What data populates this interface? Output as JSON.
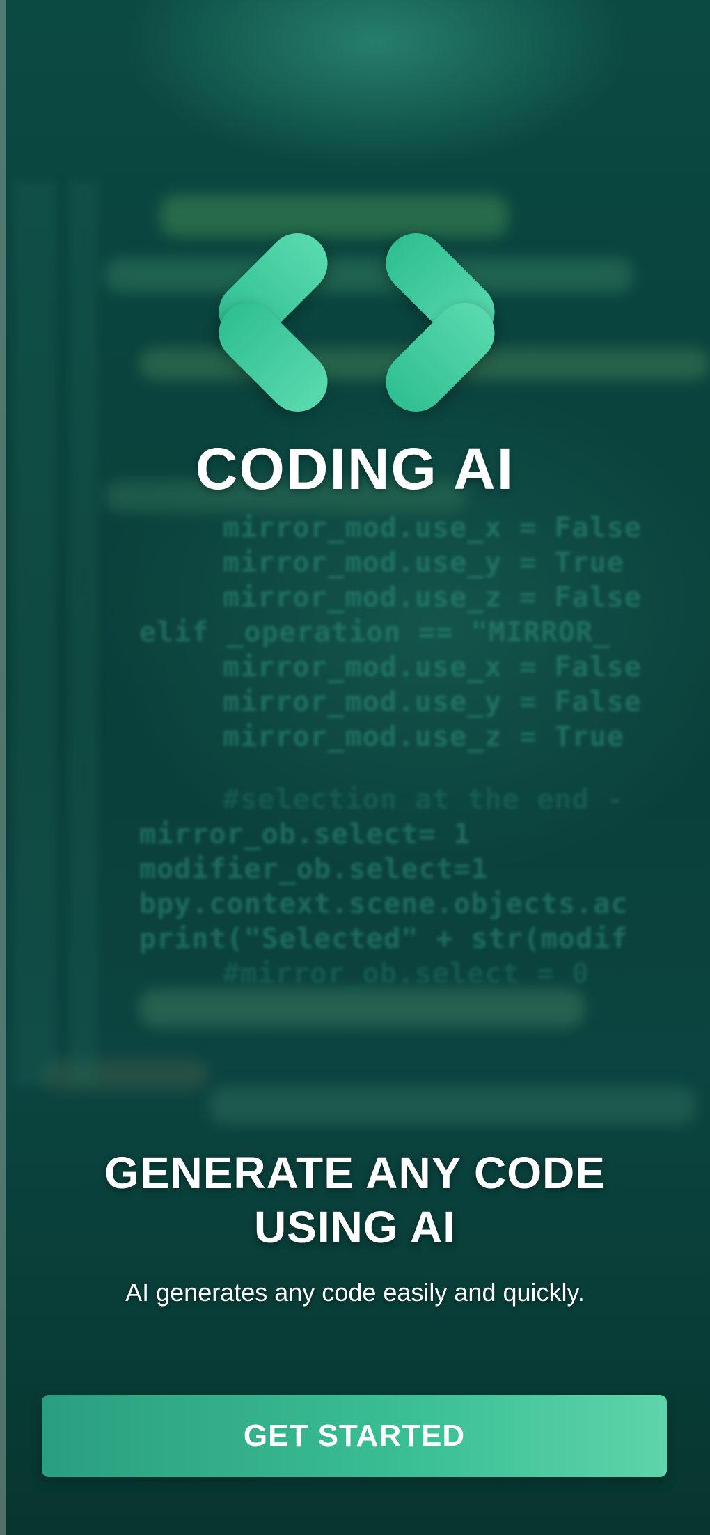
{
  "app": {
    "title": "CODING AI",
    "logo_icon": "code-brackets-icon"
  },
  "onboarding": {
    "headline_line1": "GENERATE ANY CODE",
    "headline_line2": "USING AI",
    "subtitle": "AI generates any code easily and quickly."
  },
  "cta": {
    "label": "GET STARTED"
  },
  "background": {
    "code_lines": [
      "mirror_mod.use_x = False",
      "mirror_mod.use_y = True",
      "mirror_mod.use_z = False",
      "elif _operation == \"MIRROR_",
      "mirror_mod.use_x = False",
      "mirror_mod.use_y = False",
      "mirror_mod.use_z = True",
      "#selection at the end -",
      "mirror_ob.select= 1",
      "modifier_ob.select=1",
      "bpy.context.scene.objects.ac",
      "print(\"Selected\" + str(modif",
      "#mirror_ob.select = 0"
    ]
  },
  "colors": {
    "accent": "#3bbf95",
    "accent_light": "#5ed4aa",
    "background": "#0a3f3a"
  }
}
